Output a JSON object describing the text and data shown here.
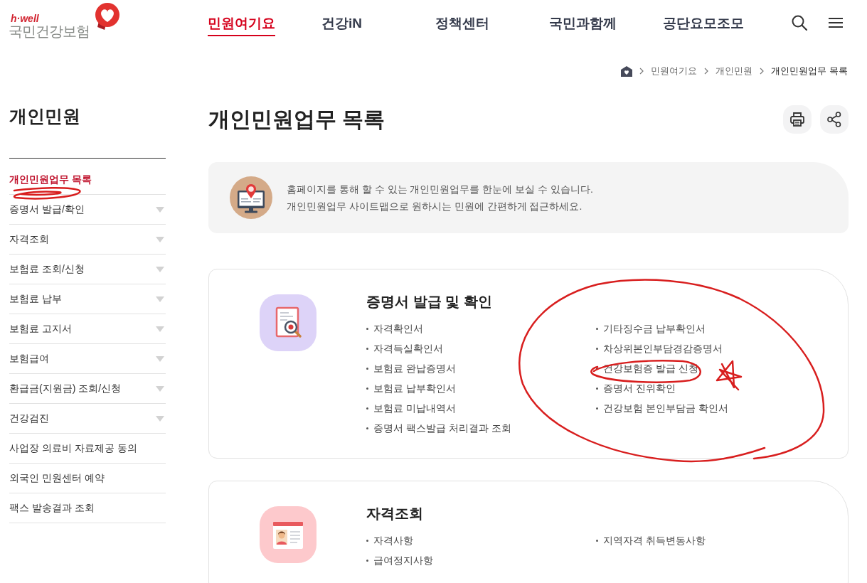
{
  "header": {
    "logo": {
      "tagline": "h·well",
      "name": "국민건강보험"
    },
    "nav": [
      {
        "label": "민원여기요",
        "selected": true
      },
      {
        "label": "건강iN",
        "selected": false
      },
      {
        "label": "정책센터",
        "selected": false
      },
      {
        "label": "국민과함께",
        "selected": false
      },
      {
        "label": "공단요모조모",
        "selected": false
      }
    ]
  },
  "breadcrumb": [
    {
      "label": "민원여기요",
      "current": false
    },
    {
      "label": "개인민원",
      "current": false
    },
    {
      "label": "개인민원업무 목록",
      "current": true
    }
  ],
  "sidebar": {
    "title": "개인민원",
    "items": [
      {
        "label": "개인민원업무 목록",
        "selected": true,
        "expandable": false
      },
      {
        "label": "증명서 발급/확인",
        "selected": false,
        "expandable": true
      },
      {
        "label": "자격조회",
        "selected": false,
        "expandable": true
      },
      {
        "label": "보험료 조회/신청",
        "selected": false,
        "expandable": true
      },
      {
        "label": "보험료 납부",
        "selected": false,
        "expandable": true
      },
      {
        "label": "보험료 고지서",
        "selected": false,
        "expandable": true
      },
      {
        "label": "보험급여",
        "selected": false,
        "expandable": true
      },
      {
        "label": "환급금(지원금) 조회/신청",
        "selected": false,
        "expandable": true
      },
      {
        "label": "건강검진",
        "selected": false,
        "expandable": true
      },
      {
        "label": "사업장 의료비 자료제공 동의",
        "selected": false,
        "expandable": false
      },
      {
        "label": "외국인 민원센터 예약",
        "selected": false,
        "expandable": false
      },
      {
        "label": "팩스 발송결과 조회",
        "selected": false,
        "expandable": false
      }
    ]
  },
  "page": {
    "title": "개인민원업무 목록"
  },
  "intro": {
    "lines": [
      "홈페이지를 통해 할 수 있는 개인민원업무를 한눈에 보실 수 있습니다.",
      "개인민원업무 사이트맵으로 원하시는 민원에 간편하게 접근하세요."
    ]
  },
  "sections": [
    {
      "kind": "certificate",
      "title": "증명서 발급 및 확인",
      "columns": [
        [
          "자격확인서",
          "자격득실확인서",
          "보험료 완납증명서",
          "보험료 납부확인서",
          "보험료 미납내역서",
          "증명서 팩스발급 처리결과 조회"
        ],
        [
          "기타징수금 납부확인서",
          "차상위본인부담경감증명서",
          "건강보험증 발급 신청",
          "증명서 진위확인",
          "건강보험 본인부담금 확인서"
        ]
      ]
    },
    {
      "kind": "eligibility",
      "title": "자격조회",
      "columns": [
        [
          "자격사항",
          "급여정지사항"
        ],
        [
          "지역자격 취득변동사항"
        ]
      ]
    }
  ],
  "annotations": [
    {
      "kind": "underline"
    },
    {
      "kind": "circle"
    },
    {
      "kind": "loop"
    },
    {
      "kind": "star"
    }
  ]
}
